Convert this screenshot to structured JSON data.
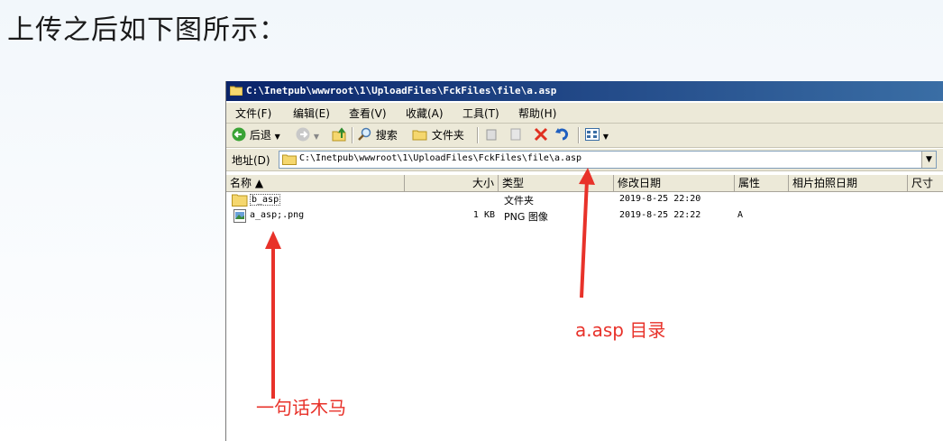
{
  "heading": "上传之后如下图所示：",
  "window": {
    "title": "C:\\Inetpub\\wwwroot\\1\\UploadFiles\\FckFiles\\file\\a.asp"
  },
  "menu": [
    "文件(F)",
    "编辑(E)",
    "查看(V)",
    "收藏(A)",
    "工具(T)",
    "帮助(H)"
  ],
  "toolbar": {
    "back_label": "后退",
    "search_label": "搜索",
    "folders_label": "文件夹"
  },
  "address": {
    "label": "地址(D)",
    "value": "C:\\Inetpub\\wwwroot\\1\\UploadFiles\\FckFiles\\file\\a.asp"
  },
  "columns": {
    "name": "名称 ▲",
    "size": "大小",
    "type": "类型",
    "modified": "修改日期",
    "attributes": "属性",
    "photo_date": "相片拍照日期",
    "dimensions": "尺寸"
  },
  "files": [
    {
      "name": "b_asp",
      "size": "",
      "type": "文件夹",
      "modified": "2019-8-25 22:20",
      "attr": ""
    },
    {
      "name": "a_asp;.png",
      "size": "1 KB",
      "type": "PNG 图像",
      "modified": "2019-8-25 22:22",
      "attr": "A"
    }
  ],
  "annotations": {
    "dir_note": "a.asp 目录",
    "file_note": "一句话木马"
  },
  "colors": {
    "annotation": "#e8322a",
    "titlebar_start": "#0a246a",
    "titlebar_end": "#3a6ea5"
  }
}
